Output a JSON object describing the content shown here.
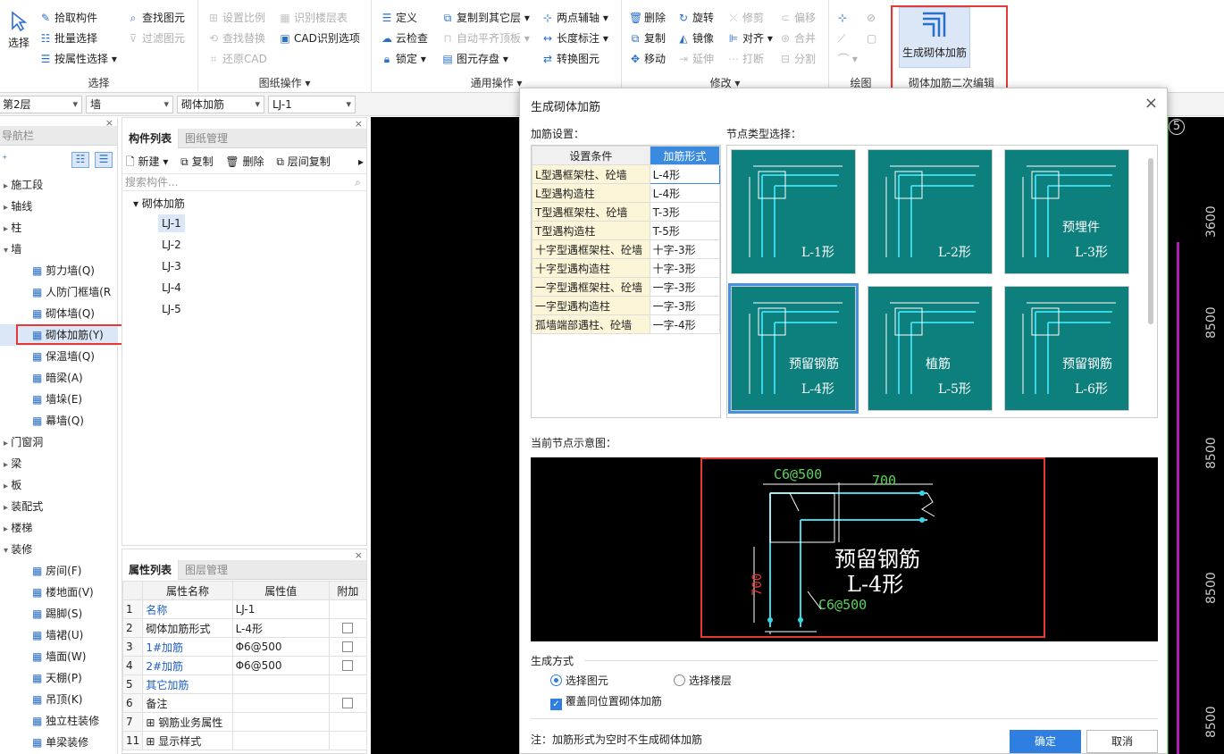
{
  "ribbon": {
    "select_group": {
      "big_button": "选择",
      "items": [
        "拾取构件",
        "批量选择",
        "按属性选择",
        "查找图元",
        "过滤图元"
      ],
      "label": "选择"
    },
    "drawing_ops_group": {
      "items": [
        "设置比例",
        "识别楼层表",
        "查找替换",
        "CAD识别选项",
        "还原CAD"
      ],
      "label": "图纸操作"
    },
    "common_ops_group": {
      "items": [
        "定义",
        "复制到其它层",
        "两点辅轴",
        "云检查",
        "自动平齐顶板",
        "长度标注",
        "锁定",
        "图元存盘",
        "转换图元"
      ],
      "label": "通用操作"
    },
    "modify_group": {
      "items": [
        "删除",
        "旋转",
        "修剪",
        "偏移",
        "复制",
        "镜像",
        "对齐",
        "合并",
        "移动",
        "延伸",
        "打断",
        "分割"
      ],
      "label": "修改"
    },
    "draw_group": {
      "label": "绘图"
    },
    "masonry_group": {
      "big_button": "生成砌体加筋",
      "label": "砌体加筋二次编辑"
    }
  },
  "toolbar2": {
    "floor": "第2层",
    "category": "墙",
    "type": "砌体加筋",
    "item": "LJ-1"
  },
  "nav": {
    "title": "导航栏",
    "tree": [
      {
        "label": "施工段",
        "level": 0,
        "arrow": "▸"
      },
      {
        "label": "轴线",
        "level": 0,
        "arrow": "▸"
      },
      {
        "label": "柱",
        "level": 0,
        "arrow": "▸"
      },
      {
        "label": "墙",
        "level": 0,
        "arrow": "▾"
      },
      {
        "label": "剪力墙(Q)",
        "level": 1
      },
      {
        "label": "人防门框墙(R",
        "level": 1
      },
      {
        "label": "砌体墙(Q)",
        "level": 1
      },
      {
        "label": "砌体加筋(Y)",
        "level": 1,
        "selected": true
      },
      {
        "label": "保温墙(Q)",
        "level": 1
      },
      {
        "label": "暗梁(A)",
        "level": 1
      },
      {
        "label": "墙垛(E)",
        "level": 1
      },
      {
        "label": "幕墙(Q)",
        "level": 1
      },
      {
        "label": "门窗洞",
        "level": 0,
        "arrow": "▸"
      },
      {
        "label": "梁",
        "level": 0,
        "arrow": "▸"
      },
      {
        "label": "板",
        "level": 0,
        "arrow": "▸"
      },
      {
        "label": "装配式",
        "level": 0,
        "arrow": "▸"
      },
      {
        "label": "楼梯",
        "level": 0,
        "arrow": "▸"
      },
      {
        "label": "装修",
        "level": 0,
        "arrow": "▾"
      },
      {
        "label": "房间(F)",
        "level": 1
      },
      {
        "label": "楼地面(V)",
        "level": 1
      },
      {
        "label": "踢脚(S)",
        "level": 1
      },
      {
        "label": "墙裙(U)",
        "level": 1
      },
      {
        "label": "墙面(W)",
        "level": 1
      },
      {
        "label": "天棚(P)",
        "level": 1
      },
      {
        "label": "吊顶(K)",
        "level": 1
      },
      {
        "label": "独立柱装修",
        "level": 1
      },
      {
        "label": "单梁装修",
        "level": 1
      }
    ]
  },
  "comp_list": {
    "tabs": [
      "构件列表",
      "图纸管理"
    ],
    "actions": [
      "新建",
      "复制",
      "删除",
      "层间复制"
    ],
    "search_placeholder": "搜索构件...",
    "root": "砌体加筋",
    "items": [
      "LJ-1",
      "LJ-2",
      "LJ-3",
      "LJ-4",
      "LJ-5"
    ]
  },
  "props": {
    "tabs": [
      "属性列表",
      "图层管理"
    ],
    "headers": [
      "属性名称",
      "属性值",
      "附加"
    ],
    "rows": [
      {
        "no": "1",
        "name": "名称",
        "value": "LJ-1",
        "blue": true,
        "check": false
      },
      {
        "no": "2",
        "name": "砌体加筋形式",
        "value": "L-4形",
        "blue": false,
        "check": true
      },
      {
        "no": "3",
        "name": "1#加筋",
        "value": "Φ6@500",
        "blue": true,
        "check": true
      },
      {
        "no": "4",
        "name": "2#加筋",
        "value": "Φ6@500",
        "blue": true,
        "check": true
      },
      {
        "no": "5",
        "name": "其它加筋",
        "value": "",
        "blue": true,
        "check": false
      },
      {
        "no": "6",
        "name": "备注",
        "value": "",
        "blue": false,
        "check": true
      },
      {
        "no": "7",
        "name": "钢筋业务属性",
        "value": "",
        "blue": false,
        "check": false,
        "expand": true
      },
      {
        "no": "11",
        "name": "显示样式",
        "value": "",
        "blue": false,
        "check": false,
        "expand": true
      }
    ]
  },
  "cad": {
    "rulers": [
      "3600",
      "8500",
      "8500",
      "8500",
      "8500"
    ],
    "circle": "5"
  },
  "dialog": {
    "title": "生成砌体加筋",
    "settings_label": "加筋设置：",
    "headers": [
      "设置条件",
      "加筋形式"
    ],
    "config": [
      [
        "L型遇框架柱、砼墙",
        "L-4形"
      ],
      [
        "L型遇构造柱",
        "L-4形"
      ],
      [
        "T型遇框架柱、砼墙",
        "T-3形"
      ],
      [
        "T型遇构造柱",
        "T-5形"
      ],
      [
        "十字型遇框架柱、砼墙",
        "十字-3形"
      ],
      [
        "十字型遇构造柱",
        "十字-3形"
      ],
      [
        "一字型遇框架柱、砼墙",
        "一字-3形"
      ],
      [
        "一字型遇构造柱",
        "一字-3形"
      ],
      [
        "孤墙端部遇柱、砼墙",
        "一字-4形"
      ]
    ],
    "node_label": "节点类型选择：",
    "nodes": [
      {
        "name": "L-1形",
        "sub": ""
      },
      {
        "name": "L-2形",
        "sub": ""
      },
      {
        "name": "L-3形",
        "sub": "预埋件"
      },
      {
        "name": "L-4形",
        "sub": "预留钢筋",
        "selected": true
      },
      {
        "name": "L-5形",
        "sub": "植筋"
      },
      {
        "name": "L-6形",
        "sub": "预留钢筋"
      }
    ],
    "preview_label": "当前节点示意图：",
    "preview": {
      "top_bar": "C6@500",
      "length": "700",
      "side_length": "700",
      "name1": "预留钢筋",
      "name2": "L-4形",
      "bottom_bar": "C6@500"
    },
    "gen_label": "生成方式",
    "radio1": "选择图元",
    "radio2": "选择楼层",
    "checkbox": "覆盖同位置砌体加筋",
    "note": "注：加筋形式为空时不生成砌体加筋",
    "ok": "确定",
    "cancel": "取消"
  }
}
